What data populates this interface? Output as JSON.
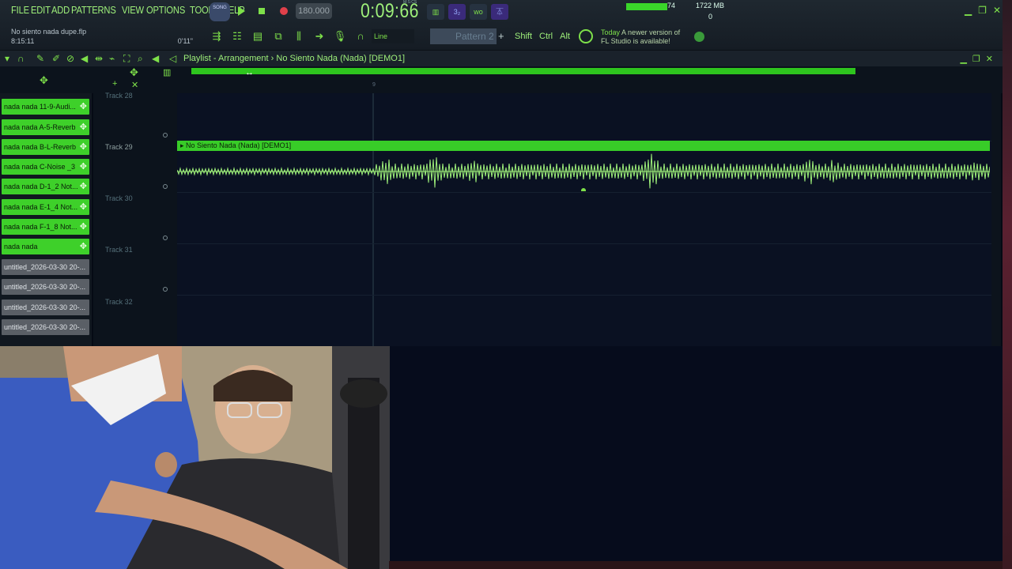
{
  "menu": [
    "FILE",
    "EDIT",
    "ADD",
    "PATTERNS",
    "VIEW",
    "OPTIONS",
    "TOOLS",
    "HELP"
  ],
  "file": {
    "name": "No siento nada dupe.flp",
    "time": "8:15:11",
    "duration": "0'11\""
  },
  "mode": "SONG",
  "tempo": "180.000",
  "song_time": "0:09:66",
  "time_unit": "M:S:CS",
  "status": {
    "cpu": "74",
    "ram": "1722 MB",
    "polyphony": "0"
  },
  "snap": "Line",
  "pattern": "Pattern 2",
  "modifiers": [
    "Shift",
    "Ctrl",
    "Alt"
  ],
  "news": {
    "today": "Today",
    "line1": "A newer version of",
    "line2": "FL Studio is available!"
  },
  "playlist": {
    "title": "Playlist - Arrangement › No Siento Nada (Nada) [DEMO1]",
    "ruler_mark": "9"
  },
  "patterns": [
    {
      "label": "nada nada 11-9-Audi...",
      "style": "green"
    },
    {
      "label": "nada nada A-5-Reverb",
      "style": "green"
    },
    {
      "label": "nada nada B-L-Reverb",
      "style": "green"
    },
    {
      "label": "nada nada C-Noise _3",
      "style": "green"
    },
    {
      "label": "nada nada D-1_2 Not...",
      "style": "green"
    },
    {
      "label": "nada nada E-1_4 Not...",
      "style": "green"
    },
    {
      "label": "nada nada F-1_8 Not...",
      "style": "green"
    },
    {
      "label": "nada nada",
      "style": "green"
    },
    {
      "label": "untitled_2026-03-30 20-...",
      "style": "gray"
    },
    {
      "label": "untitled_2026-03-30 20-...",
      "style": "gray"
    },
    {
      "label": "untitled_2026-03-30 20-...",
      "style": "gray"
    },
    {
      "label": "untitled_2026-03-30 20-...",
      "style": "gray"
    }
  ],
  "tracks": [
    "Track 28",
    "Track 29",
    "Track 30",
    "Track 31",
    "Track 32"
  ],
  "clip": {
    "name": "No Siento Nada (Nada) [DEMO1]"
  },
  "colors": {
    "accent": "#7ee04a",
    "clip": "#38cc28",
    "grid_bg": "#0a1122"
  }
}
